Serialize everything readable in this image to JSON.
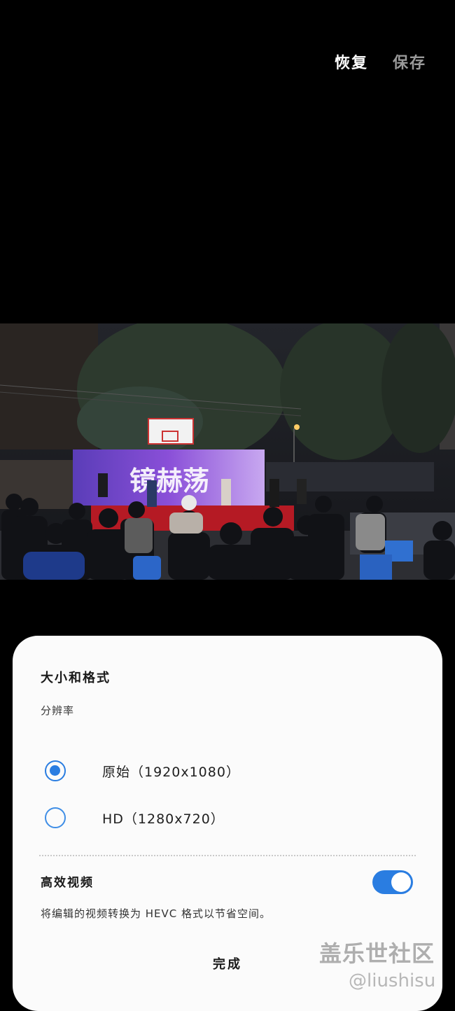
{
  "top_bar": {
    "restore_label": "恢复",
    "save_label": "保存"
  },
  "preview": {
    "stage_banner_text": "镜赫荡"
  },
  "sheet": {
    "title": "大小和格式",
    "resolution_label": "分辨率",
    "options": [
      {
        "label": "原始（1920x1080）",
        "selected": true
      },
      {
        "label": "HD（1280x720）",
        "selected": false
      }
    ],
    "hevc": {
      "title": "高效视频",
      "description": "将编辑的视频转换为 HEVC 格式以节省空间。",
      "enabled": true
    },
    "done_label": "完成"
  },
  "watermark": {
    "line1": "盖乐世社区",
    "line2": "@liushisu"
  },
  "colors": {
    "accent": "#2a7de1",
    "background": "#000000",
    "sheet": "#fbfbfb"
  }
}
